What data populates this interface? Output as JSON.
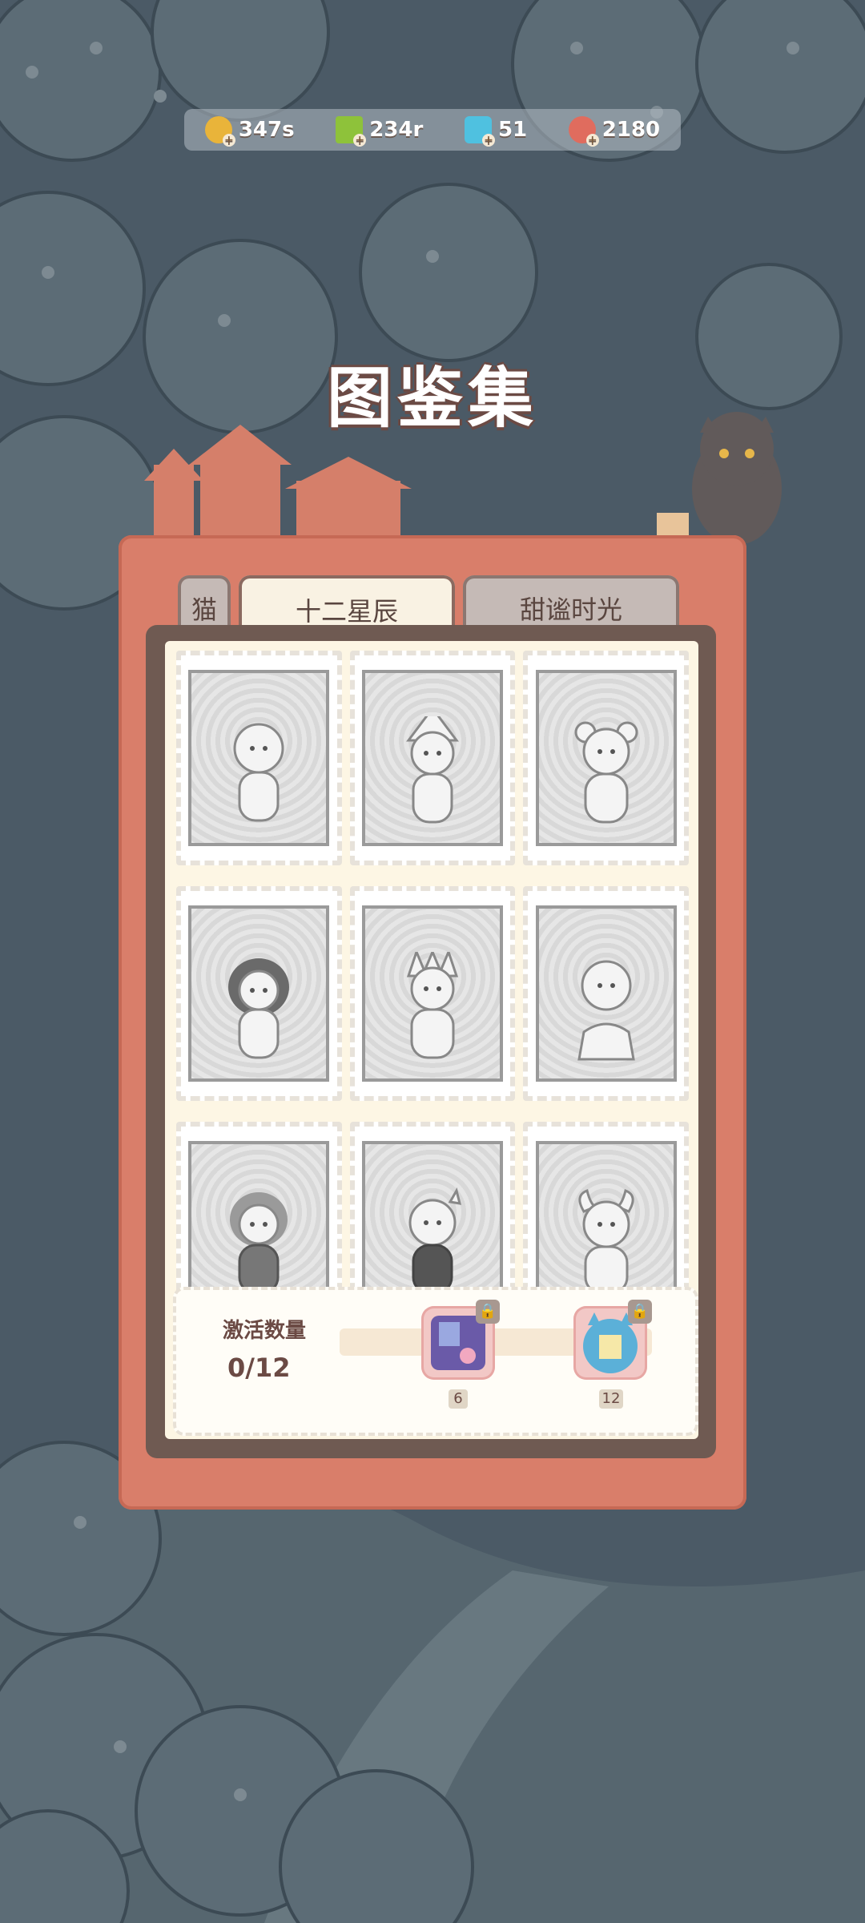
{
  "currencies": [
    {
      "icon": "gold-coin-icon",
      "value": "347s",
      "color": "#e9b43a"
    },
    {
      "icon": "energy-bolt-icon",
      "value": "234r",
      "color": "#8ec23a"
    },
    {
      "icon": "blue-gem-icon",
      "value": "51",
      "color": "#4fc1e0"
    },
    {
      "icon": "red-shell-icon",
      "value": "2180",
      "color": "#e06c5e"
    }
  ],
  "title": "图鉴集",
  "tabs": [
    {
      "label": "猫",
      "state": "inactive"
    },
    {
      "label": "十二星辰",
      "state": "active"
    },
    {
      "label": "甜谧时光",
      "state": "inactive"
    }
  ],
  "cards": [
    {
      "name": "card-1"
    },
    {
      "name": "card-2"
    },
    {
      "name": "card-3"
    },
    {
      "name": "card-4"
    },
    {
      "name": "card-5"
    },
    {
      "name": "card-6"
    },
    {
      "name": "card-7"
    },
    {
      "name": "card-8"
    },
    {
      "name": "card-9"
    }
  ],
  "progress": {
    "label": "激活数量",
    "count": "0/12",
    "rewards": [
      {
        "milestone": "6",
        "icon": "starry-room-icon",
        "locked": true
      },
      {
        "milestone": "12",
        "icon": "cat-frame-icon",
        "locked": true
      }
    ]
  },
  "colors": {
    "panel": "#d97e6a",
    "paper": "#fdf6e4",
    "background": "#4a5a66"
  }
}
